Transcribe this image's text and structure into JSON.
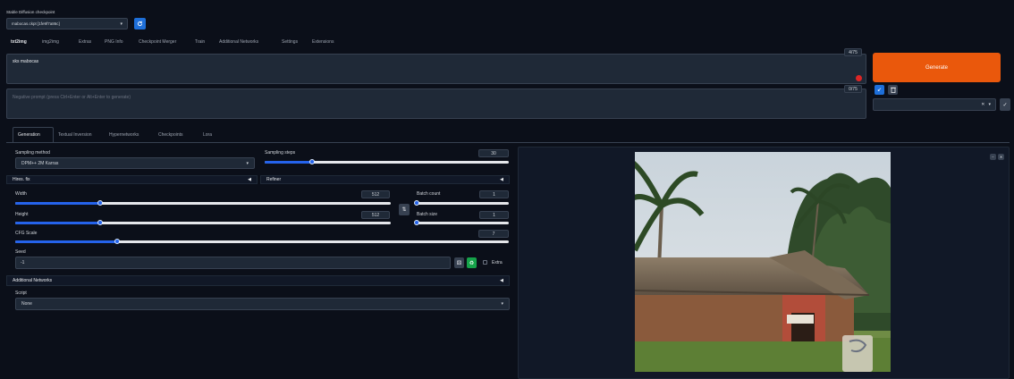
{
  "checkpoint": {
    "label": "Stable Diffusion checkpoint",
    "value": "mabocas.ckpt [1fe9f7a86c]",
    "refresh_icon": "refresh-icon"
  },
  "tabs": [
    "txt2img",
    "img2img",
    "Extras",
    "PNG Info",
    "Checkpoint Merger",
    "Train",
    "Additional Networks",
    "Settings",
    "Extensions"
  ],
  "prompt": {
    "value": "sks mabocas",
    "token_count": "4/75",
    "negative_placeholder": "Negative prompt (press Ctrl+Enter or Alt+Enter to generate)",
    "negative_token_count": "0/75"
  },
  "generate": {
    "label": "Generate",
    "color": "#ea580c"
  },
  "sub_tabs": [
    "Generation",
    "Textual Inversion",
    "Hypernetworks",
    "Checkpoints",
    "Lora"
  ],
  "sampling": {
    "method_label": "Sampling method",
    "method_value": "DPM++ 2M Karras",
    "steps_label": "Sampling steps",
    "steps_value": "30",
    "steps_min": 1,
    "steps_max": 150
  },
  "hires_label": "Hires. fix",
  "refiner_label": "Refiner",
  "width": {
    "label": "Width",
    "value": "512",
    "min": 64,
    "max": 2048
  },
  "height": {
    "label": "Height",
    "value": "512",
    "min": 64,
    "max": 2048
  },
  "batch_count": {
    "label": "Batch count",
    "value": "1",
    "min": 1,
    "max": 100
  },
  "batch_size": {
    "label": "Batch size",
    "value": "1",
    "min": 1,
    "max": 8
  },
  "cfg": {
    "label": "CFG Scale",
    "value": "7",
    "min": 1,
    "max": 30
  },
  "seed": {
    "label": "Seed",
    "value": "-1",
    "extra_label": "Extra"
  },
  "additional_networks_label": "Additional Networks",
  "script": {
    "label": "Script",
    "value": "None"
  },
  "colors": {
    "accent": "#2563eb",
    "background": "#0b0f19",
    "generate": "#ea580c"
  }
}
